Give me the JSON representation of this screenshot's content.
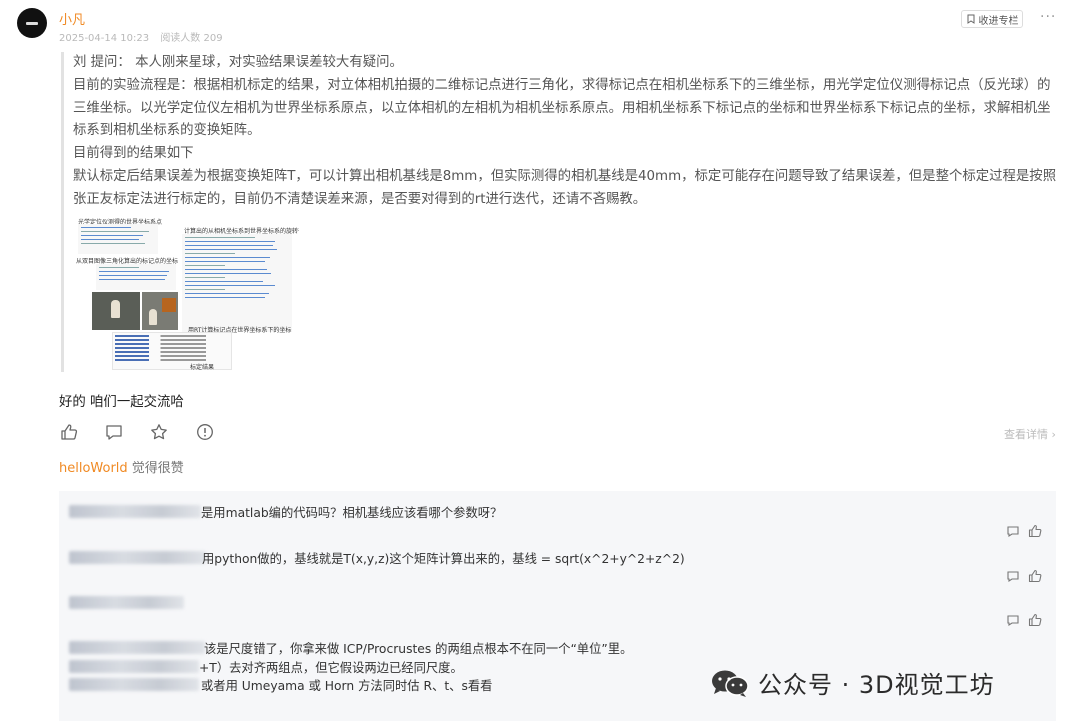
{
  "post": {
    "author": "小凡",
    "date": "2025-04-14 10:23",
    "read_count": "阅读人数 209",
    "collect_label": "收进专栏"
  },
  "quote": {
    "line1": "刘  提问：  本人刚来星球，对实验结果误差较大有疑问。",
    "para1": "目前的实验流程是：根据相机标定的结果，对立体相机拍摄的二维标记点进行三角化，求得标记点在相机坐标系下的三维坐标，用光学定位仪测得标记点（反光球）的三维坐标。以光学定位仪左相机为世界坐标系原点，以立体相机的左相机为相机坐标系原点。用相机坐标系下标记点的坐标和世界坐标系下标记点的坐标，求解相机坐标系到相机坐标系的变换矩阵。",
    "line_result": "目前得到的结果如下",
    "para2": "默认标定后结果误差为根据变换矩阵T，可以计算出相机基线是8mm，但实际测得的相机基线是40mm，标定可能存在问题导致了结果误差，但是整个标定过程是按照张正友标定法进行标定的，目前仍不清楚误差来源，是否要对得到的rt进行迭代，还请不吝赐教。",
    "thumb_labels": {
      "t1": "光学定位仪测得的世界坐标系点",
      "t2": "计算出的从相机坐标系到世界坐标系的旋转平移矩阵",
      "t3": "从双目图像三角化算出的标记点的坐标",
      "t4": "用RT计算标记点在世界坐标系下的坐标",
      "t5": "标定结果"
    }
  },
  "reply_text": "好的 咱们一起交流哈",
  "actions": {
    "detail_link": "查看详情 ›"
  },
  "likes": {
    "likers": "helloWorld",
    "suffix": " 觉得很赞"
  },
  "comments": [
    {
      "text": "是用matlab编的代码吗？相机基线应该看哪个参数呀？"
    },
    {
      "text": "用python做的，基线就是T(x,y,z)这个矩阵计算出来的，基线 = sqrt(x^2+y^2+z^2)"
    },
    {
      "text": ""
    },
    {
      "line1": "该是尺度错了，你拿来做 ICP/Procrustes 的两组点根本不在同一个“单位”里。",
      "line2": "+T）去对齐两组点，但它假设两边已经同尺度。",
      "line3": "或者用 Umeyama 或 Horn 方法同时估 R、t、s看看"
    }
  ],
  "watermark": "公众号 · 3D视觉工坊",
  "icons": [
    "more-icon",
    "bookmark-icon",
    "thumbs-up-icon",
    "comment-icon",
    "star-icon",
    "report-icon",
    "wechat-icon"
  ]
}
